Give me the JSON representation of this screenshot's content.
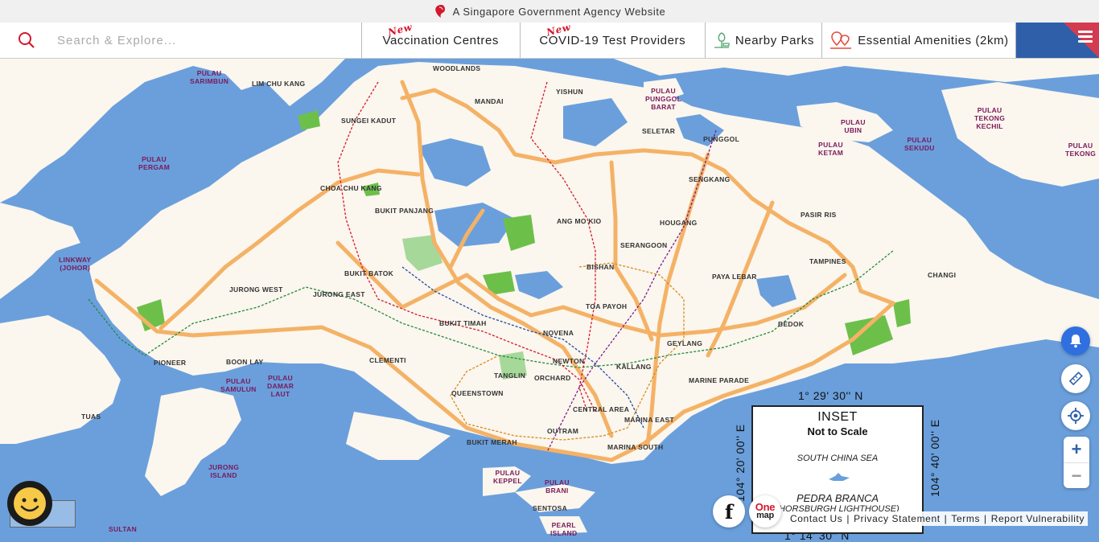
{
  "gov_banner": {
    "text": "A Singapore Government Agency Website"
  },
  "search": {
    "placeholder": "Search & Explore..."
  },
  "tabs": [
    {
      "badge": "New",
      "label": "Vaccination Centres"
    },
    {
      "badge": "New",
      "label": "COVID-19 Test Providers"
    },
    {
      "label": "Nearby Parks",
      "icon": "park-icon"
    },
    {
      "label": "Essential Amenities (2km)",
      "icon": "amenities-pin-icon"
    }
  ],
  "map_labels": {
    "pulau_sarimbun": "PULAU\nSARIMBUN",
    "lim_chu_kang": "LIM CHU KANG",
    "woodlands": "WOODLANDS",
    "mandai": "MANDAI",
    "yishun": "YISHUN",
    "pulau_punggol_barat": "PULAU\nPUNGGOL\nBARAT",
    "seletar": "SELETAR",
    "punggol": "PUNGGOL",
    "sungei_kadut": "SUNGEI KADUT",
    "pulau_pergam": "PULAU\nPERGAM",
    "choa_chu_kang": "CHOA CHU KANG",
    "bukit_panjang": "BUKIT PANJANG",
    "sengkang": "SENGKANG",
    "pulau_ubin": "PULAU\nUBIN",
    "pulau_ketam": "PULAU\nKETAM",
    "pulau_sekudu": "PULAU\nSEKUDU",
    "pulau_tekong_kechil": "PULAU\nTEKONG\nKECHIL",
    "pulau_tekong": "PULAU\nTEKONG",
    "ang_mo_kio": "ANG MO KIO",
    "hougang": "HOUGANG",
    "pasir_ris": "PASIR RIS",
    "linkway_johor": "LINKWAY\n(JOHOR)",
    "serangoon": "SERANGOON",
    "tampines": "TAMPINES",
    "jurong_west": "JURONG WEST",
    "bukit_batok": "BUKIT BATOK",
    "bishan": "BISHAN",
    "paya_lebar": "PAYA LEBAR",
    "changi": "CHANGI",
    "jurong_east": "JURONG EAST",
    "toa_payoh": "TOA PAYOH",
    "bukit_timah": "BUKIT TIMAH",
    "bedok": "BEDOK",
    "novena": "NOVENA",
    "geylang": "GEYLANG",
    "pioneer": "PIONEER",
    "boon_lay": "BOON LAY",
    "clementi": "CLEMENTI",
    "newton": "NEWTON",
    "kallang": "KALLANG",
    "tanglin": "TANGLIN",
    "orchard": "ORCHARD",
    "pulau_samulun": "PULAU\nSAMULUN",
    "pulau_damar_laut": "PULAU\nDAMAR\nLAUT",
    "marine_parade": "MARINE PARADE",
    "queenstown": "QUEENSTOWN",
    "tuas": "TUAS",
    "central_area": "CENTRAL AREA",
    "marina_east": "MARINA EAST",
    "outram": "OUTRAM",
    "bukit_merah": "BUKIT MERAH",
    "marina_south": "MARINA SOUTH",
    "jurong_island": "JURONG\nISLAND",
    "pulau_keppel": "PULAU\nKEPPEL",
    "pulau_brani": "PULAU\nBRANI",
    "sentosa": "SENTOSA",
    "pearl_island": "PEARL\nISLAND",
    "sultan": "SULTAN"
  },
  "inset": {
    "title": "INSET",
    "subtitle": "Not to Scale",
    "sea": "SOUTH CHINA SEA",
    "rock": "PEDRA BRANCA",
    "lighthouse": "(HORSBURGH LIGHTHOUSE)",
    "coord_top": "1° 29' 30'' N",
    "coord_bottom": "1° 14' 30'' N",
    "coord_left": "104° 20' 00'' E",
    "coord_right": "104° 40' 00'' E"
  },
  "footer": {
    "contact": "Contact Us",
    "privacy": "Privacy Statement",
    "terms": "Terms",
    "report": "Report Vulnerability",
    "separator": "|"
  },
  "social": {
    "facebook": "f",
    "onemap_one": "One",
    "onemap_map": "map"
  },
  "zoom": {
    "in": "+",
    "out": "−"
  },
  "colors": {
    "sea": "#6a9fdc",
    "land": "#fbf6ee",
    "expressway": "#f4b266",
    "park": "#6cc04a",
    "brand_red": "#d3192c",
    "brand_blue": "#2f5fa9"
  },
  "icons": {
    "gov": "lion-head-icon",
    "search": "search-icon",
    "menu": "hamburger-menu-icon",
    "notify": "bell-icon",
    "measure": "ruler-icon",
    "locate": "crosshair-icon",
    "feedback": "smiley-icon"
  }
}
